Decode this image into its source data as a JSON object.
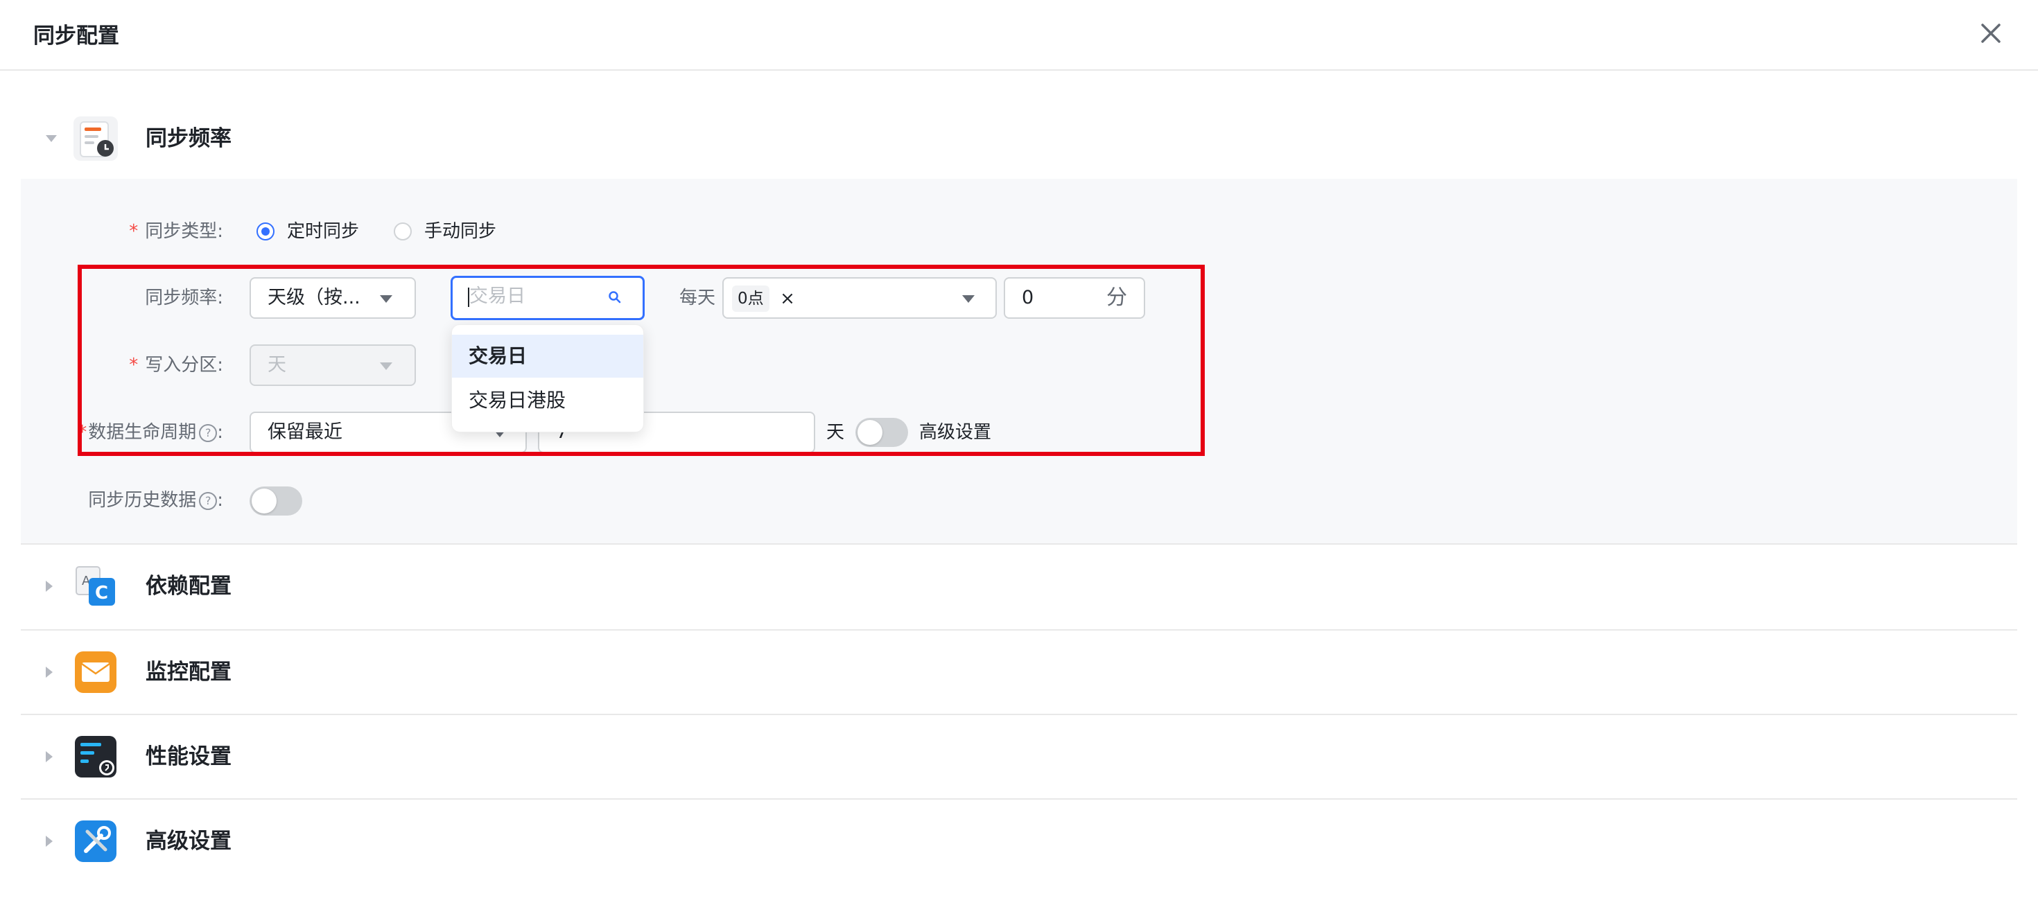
{
  "dialog": {
    "title": "同步配置"
  },
  "sections": [
    {
      "title": "同步频率",
      "expanded": true
    },
    {
      "title": "依赖配置",
      "expanded": false
    },
    {
      "title": "监控配置",
      "expanded": false
    },
    {
      "title": "性能设置",
      "expanded": false
    },
    {
      "title": "高级设置",
      "expanded": false
    }
  ],
  "form": {
    "sync_type": {
      "label": "同步类型:",
      "options": [
        "定时同步",
        "手动同步"
      ],
      "selected": "定时同步"
    },
    "sync_freq": {
      "label": "同步频率:",
      "level_value": "天级（按...",
      "calendar_placeholder": "交易日",
      "each_day_label": "每天",
      "hour_tag": "0点",
      "minute_value": "0",
      "minute_unit": "分"
    },
    "partition": {
      "label": "写入分区:",
      "value": "天"
    },
    "lifecycle": {
      "label": "数据生命周期",
      "suffix": ":",
      "mode_value": "保留最近",
      "days_value": "7",
      "day_unit": "天",
      "advanced_label": "高级设置",
      "advanced_on": false
    },
    "history": {
      "label": "同步历史数据",
      "suffix": ":",
      "on": false
    }
  },
  "dropdown": {
    "options": [
      "交易日",
      "交易日港股"
    ],
    "highlighted": 0
  },
  "colors": {
    "primary": "#3370ff",
    "required": "#f54a45",
    "annotation": "#e60012"
  }
}
